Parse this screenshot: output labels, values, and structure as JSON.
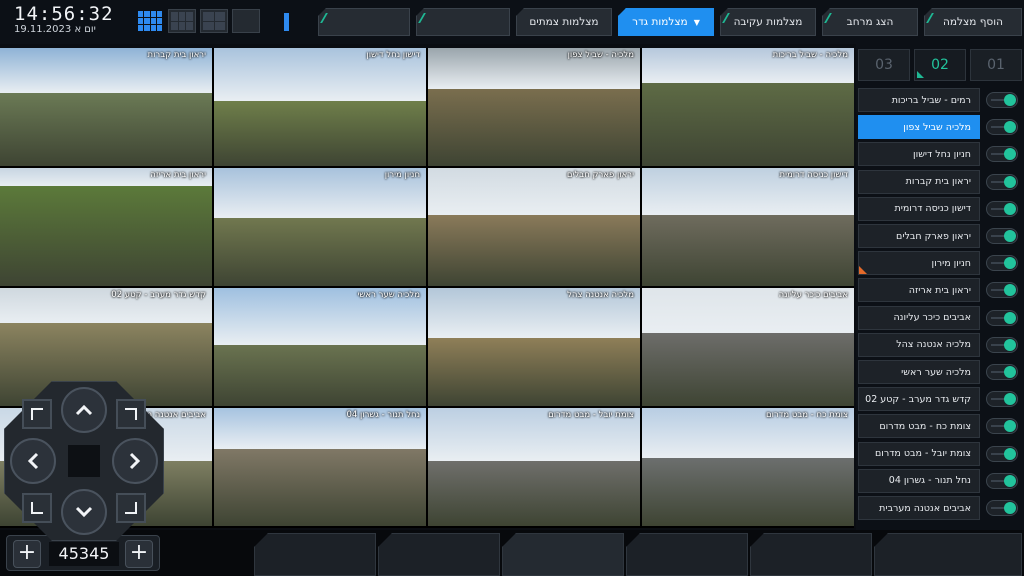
{
  "clock": {
    "time": "14:56:32",
    "date": "19.11.2023 יום א"
  },
  "top_tabs": [
    {
      "label": "",
      "active": false
    },
    {
      "label": "",
      "active": false
    },
    {
      "label": "מצלמות צמתים",
      "active": false
    },
    {
      "label": "מצלמות גדר",
      "active": true
    },
    {
      "label": "מצלמות עקיבה",
      "active": false
    },
    {
      "label": "הצג מרחב",
      "active": false
    },
    {
      "label": "הוסף מצלמה",
      "active": false
    }
  ],
  "wall": {
    "cells": [
      {
        "label": "יראון בית קברות"
      },
      {
        "label": "דישון נחל דישון"
      },
      {
        "label": "מלכיה - שביל צפון"
      },
      {
        "label": "מלכיה - שביל בריכות"
      },
      {
        "label": "יראון בית אריזה"
      },
      {
        "label": "חניון מירון"
      },
      {
        "label": "יראון פארק חבלים"
      },
      {
        "label": "דישון כניסה דרומית"
      },
      {
        "label": "קדש גדר מערב - קטע 02"
      },
      {
        "label": "מלכיה שער ראשי"
      },
      {
        "label": "מלכיה אנטנה צהל"
      },
      {
        "label": "אביבים כיכר עליונה"
      },
      {
        "label": "אביבים אנטנה מערבית"
      },
      {
        "label": "נחל תנור - גשרון 04"
      },
      {
        "label": "צומת יובל - מבט מדרום"
      },
      {
        "label": "צומת כח - מבט מדרום"
      }
    ],
    "selected_index": 2
  },
  "pages": [
    {
      "label": "03",
      "active": false
    },
    {
      "label": "02",
      "active": true
    },
    {
      "label": "01",
      "active": false
    }
  ],
  "camera_list": [
    {
      "label": "רמים - שביל בריכות",
      "active": false
    },
    {
      "label": "מלכיה שביל צפון",
      "active": true
    },
    {
      "label": "חניון נחל דישון",
      "active": false
    },
    {
      "label": "יראון בית קברות",
      "active": false
    },
    {
      "label": "דישון כניסה דרומית",
      "active": false
    },
    {
      "label": "יראון פארק חבלים",
      "active": false
    },
    {
      "label": "חניון מירון",
      "active": false
    },
    {
      "label": "יראון בית אריזה",
      "active": false
    },
    {
      "label": "אביבים כיכר עליונה",
      "active": false
    },
    {
      "label": "מלכיה אנטנה צהל",
      "active": false
    },
    {
      "label": "מלכיה שער ראשי",
      "active": false
    },
    {
      "label": "קדש גדר מערב - קטע 02",
      "active": false
    },
    {
      "label": "צומת כח - מבט מדרום",
      "active": false
    },
    {
      "label": "צומת יובל - מבט מדרום",
      "active": false
    },
    {
      "label": "נחל תנור - גשרון 04",
      "active": false
    },
    {
      "label": "אביבים אנטנה מערבית",
      "active": false
    }
  ],
  "zoom": {
    "value": "45345",
    "minus_label": "+",
    "plus_label": "+"
  },
  "colors": {
    "accent": "#1f8ff0",
    "toggle_on": "#22c39c",
    "alert": "#e46a2a"
  }
}
